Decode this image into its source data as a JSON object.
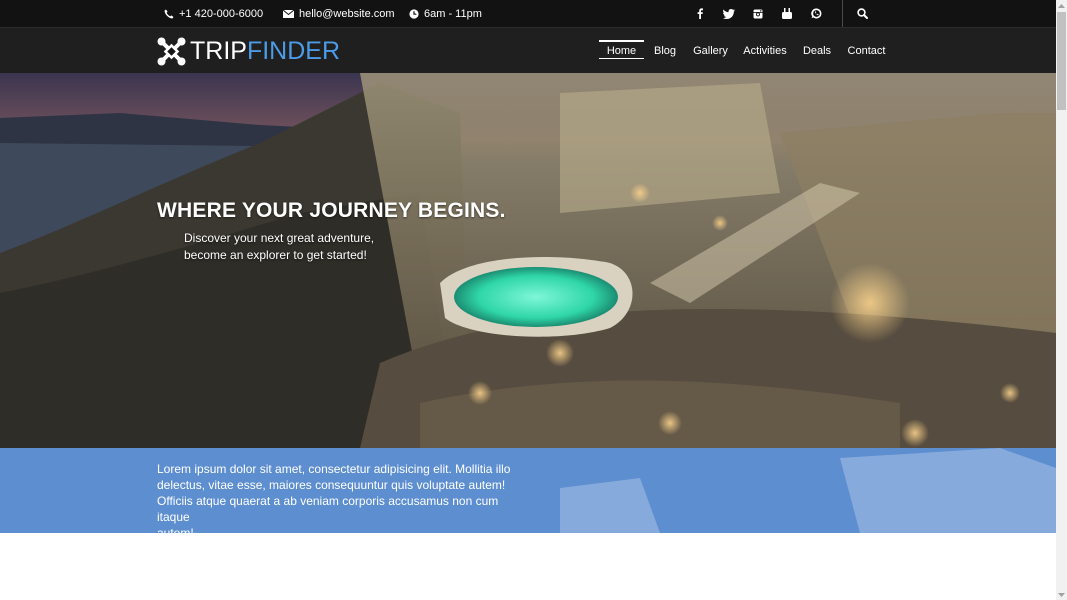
{
  "topbar": {
    "phone": "+1 420-000-6000",
    "email": "hello@website.com",
    "hours": "6am - 11pm",
    "social": [
      "facebook-icon",
      "twitter-icon",
      "instagram-icon",
      "youtube-icon",
      "whatsapp-icon"
    ]
  },
  "brand": {
    "part1": "TRIP",
    "part2": "FINDER",
    "accent": "#4b9be6"
  },
  "nav": [
    {
      "label": "Home",
      "active": true
    },
    {
      "label": "Blog"
    },
    {
      "label": "Gallery"
    },
    {
      "label": "Activities"
    },
    {
      "label": "Deals"
    },
    {
      "label": "Contact"
    }
  ],
  "hero": {
    "title": "WHERE YOUR JOURNEY BEGINS.",
    "line1": "Discover your next great adventure,",
    "line2": "become an explorer to get started!"
  },
  "band": {
    "color": "#5d8ed0",
    "lines": [
      "Lorem ipsum dolor sit amet, consectetur adipisicing elit. Mollitia illo",
      "delectus, vitae esse, maiores consequuntur quis voluptate autem!",
      "Officiis atque quaerat a ab veniam corporis accusamus non cum itaque",
      "autem!"
    ]
  }
}
